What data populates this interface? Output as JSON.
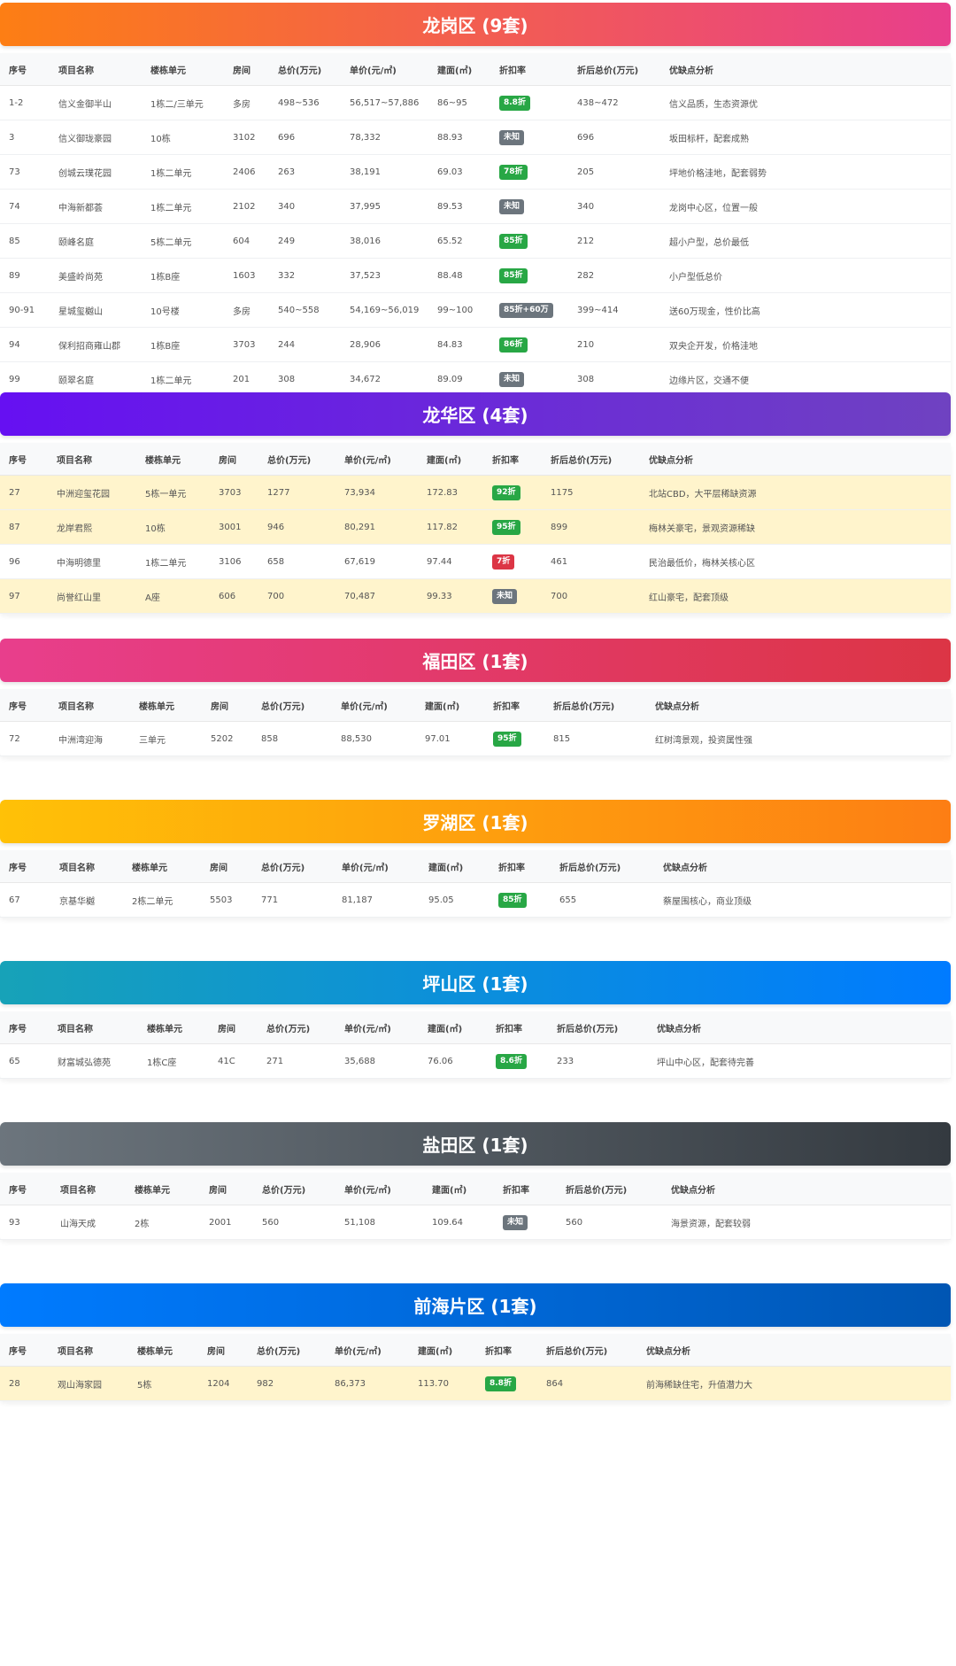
{
  "headers": [
    "序号",
    "项目名称",
    "楼栋单元",
    "房间",
    "总价(万元)",
    "单价(元/㎡)",
    "建面(㎡)",
    "折扣率",
    "折后总价(万元)",
    "优缺点分析"
  ],
  "colors": {
    "badge_green": "#28a745",
    "badge_gray": "#6c757d",
    "badge_red": "#dc3545",
    "highlight_row": "#fff4cc"
  },
  "sections": [
    {
      "title": "龙岗区 (9套)",
      "gradient": [
        "#fd7e14",
        "#e83e8c"
      ],
      "rows": [
        {
          "no": "1-2",
          "name": "信义金御半山",
          "building": "1栋二/三单元",
          "room": "多房",
          "total": "498~536",
          "unit": "56,517~57,886",
          "area": "86~95",
          "discount": "8.8折",
          "badge": "green",
          "after": "438~472",
          "analysis": "信义品质，生态资源优",
          "hl": false
        },
        {
          "no": "3",
          "name": "信义御珑豪园",
          "building": "10栋",
          "room": "3102",
          "total": "696",
          "unit": "78,332",
          "area": "88.93",
          "discount": "未知",
          "badge": "gray",
          "after": "696",
          "analysis": "坂田标杆，配套成熟",
          "hl": false
        },
        {
          "no": "73",
          "name": "创城云璞花园",
          "building": "1栋二单元",
          "room": "2406",
          "total": "263",
          "unit": "38,191",
          "area": "69.03",
          "discount": "78折",
          "badge": "green",
          "after": "205",
          "analysis": "坪地价格洼地，配套弱势",
          "hl": false
        },
        {
          "no": "74",
          "name": "中海新都荟",
          "building": "1栋二单元",
          "room": "2102",
          "total": "340",
          "unit": "37,995",
          "area": "89.53",
          "discount": "未知",
          "badge": "gray",
          "after": "340",
          "analysis": "龙岗中心区，位置一般",
          "hl": false
        },
        {
          "no": "85",
          "name": "颐峰名庭",
          "building": "5栋二单元",
          "room": "604",
          "total": "249",
          "unit": "38,016",
          "area": "65.52",
          "discount": "85折",
          "badge": "green",
          "after": "212",
          "analysis": "超小户型，总价最低",
          "hl": false
        },
        {
          "no": "89",
          "name": "美盛岭尚苑",
          "building": "1栋B座",
          "room": "1603",
          "total": "332",
          "unit": "37,523",
          "area": "88.48",
          "discount": "85折",
          "badge": "green",
          "after": "282",
          "analysis": "小户型低总价",
          "hl": false
        },
        {
          "no": "90-91",
          "name": "星城玺樾山",
          "building": "10号楼",
          "room": "多房",
          "total": "540~558",
          "unit": "54,169~56,019",
          "area": "99~100",
          "discount": "85折+60万",
          "badge": "gray",
          "after": "399~414",
          "analysis": "送60万现金，性价比高",
          "hl": false
        },
        {
          "no": "94",
          "name": "保利招商雍山郡",
          "building": "1栋B座",
          "room": "3703",
          "total": "244",
          "unit": "28,906",
          "area": "84.83",
          "discount": "86折",
          "badge": "green",
          "after": "210",
          "analysis": "双央企开发，价格洼地",
          "hl": false
        },
        {
          "no": "99",
          "name": "颐翠名庭",
          "building": "1栋二单元",
          "room": "201",
          "total": "308",
          "unit": "34,672",
          "area": "89.09",
          "discount": "未知",
          "badge": "gray",
          "after": "308",
          "analysis": "边缘片区，交通不便",
          "hl": false
        }
      ]
    },
    {
      "title": "龙华区 (4套)",
      "gradient": [
        "#6610f2",
        "#6f42c1"
      ],
      "rows": [
        {
          "no": "27",
          "name": "中洲迎玺花园",
          "building": "5栋一单元",
          "room": "3703",
          "total": "1277",
          "unit": "73,934",
          "area": "172.83",
          "discount": "92折",
          "badge": "green",
          "after": "1175",
          "analysis": "北站CBD，大平层稀缺资源",
          "hl": true
        },
        {
          "no": "87",
          "name": "龙岸君熙",
          "building": "10栋",
          "room": "3001",
          "total": "946",
          "unit": "80,291",
          "area": "117.82",
          "discount": "95折",
          "badge": "green",
          "after": "899",
          "analysis": "梅林关豪宅，景观资源稀缺",
          "hl": true
        },
        {
          "no": "96",
          "name": "中海明德里",
          "building": "1栋二单元",
          "room": "3106",
          "total": "658",
          "unit": "67,619",
          "area": "97.44",
          "discount": "7折",
          "badge": "red",
          "after": "461",
          "analysis": "民治最低价，梅林关核心区",
          "hl": false
        },
        {
          "no": "97",
          "name": "尚誉红山里",
          "building": "A座",
          "room": "606",
          "total": "700",
          "unit": "70,487",
          "area": "99.33",
          "discount": "未知",
          "badge": "gray",
          "after": "700",
          "analysis": "红山豪宅，配套顶级",
          "hl": true
        }
      ]
    },
    {
      "title": "福田区 (1套)",
      "gradient": [
        "#e83e8c",
        "#dc3545"
      ],
      "rows": [
        {
          "no": "72",
          "name": "中洲湾迎海",
          "building": "三单元",
          "room": "5202",
          "total": "858",
          "unit": "88,530",
          "area": "97.01",
          "discount": "95折",
          "badge": "green",
          "after": "815",
          "analysis": "红树湾景观，投资属性强",
          "hl": false
        }
      ]
    },
    {
      "title": "罗湖区 (1套)",
      "gradient": [
        "#ffc107",
        "#fd7e14"
      ],
      "rows": [
        {
          "no": "67",
          "name": "京基华樾",
          "building": "2栋二单元",
          "room": "5503",
          "total": "771",
          "unit": "81,187",
          "area": "95.05",
          "discount": "85折",
          "badge": "green",
          "after": "655",
          "analysis": "蔡屋围核心，商业顶级",
          "hl": false
        }
      ]
    },
    {
      "title": "坪山区 (1套)",
      "gradient": [
        "#17a2b8",
        "#007bff"
      ],
      "rows": [
        {
          "no": "65",
          "name": "财富城弘德苑",
          "building": "1栋C座",
          "room": "41C",
          "total": "271",
          "unit": "35,688",
          "area": "76.06",
          "discount": "8.6折",
          "badge": "green",
          "after": "233",
          "analysis": "坪山中心区，配套待完善",
          "hl": false
        }
      ]
    },
    {
      "title": "盐田区 (1套)",
      "gradient": [
        "#6c757d",
        "#343a40"
      ],
      "rows": [
        {
          "no": "93",
          "name": "山海天成",
          "building": "2栋",
          "room": "2001",
          "total": "560",
          "unit": "51,108",
          "area": "109.64",
          "discount": "未知",
          "badge": "gray",
          "after": "560",
          "analysis": "海景资源，配套较弱",
          "hl": false
        }
      ]
    },
    {
      "title": "前海片区 (1套)",
      "gradient": [
        "#007bff",
        "#0056b3"
      ],
      "rows": [
        {
          "no": "28",
          "name": "观山海家园",
          "building": "5栋",
          "room": "1204",
          "total": "982",
          "unit": "86,373",
          "area": "113.70",
          "discount": "8.8折",
          "badge": "green",
          "after": "864",
          "analysis": "前海稀缺住宅，升值潜力大",
          "hl": true
        }
      ]
    }
  ]
}
